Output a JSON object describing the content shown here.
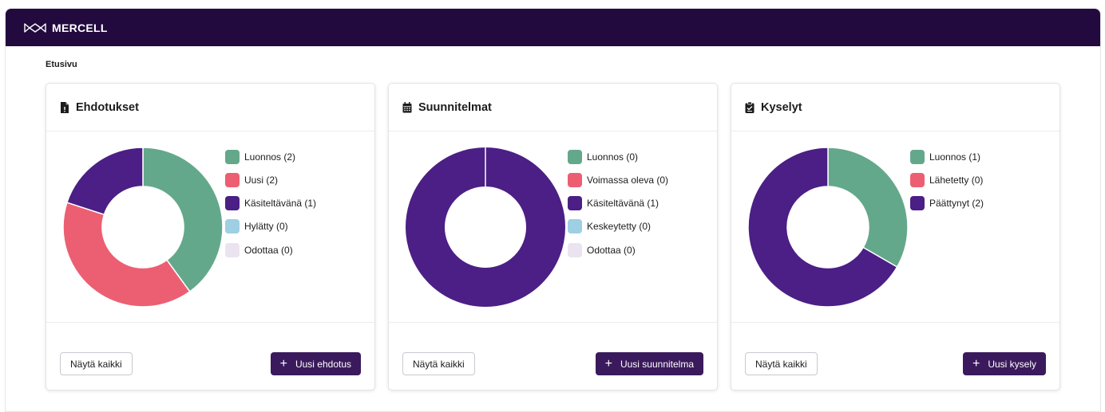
{
  "app": {
    "brand_name": "MERCELL",
    "brand_color": "#220a3f",
    "logo_icon": "mercell-logo-icon"
  },
  "breadcrumb": "Etusivu",
  "cards": [
    {
      "title": "Ehdotukset",
      "icon": "file-icon",
      "legend": [
        {
          "label": "Luonnos (2)",
          "color": "#64a88b"
        },
        {
          "label": "Uusi (2)",
          "color": "#ec5f72"
        },
        {
          "label": "Käsiteltävänä (1)",
          "color": "#4b1f85"
        },
        {
          "label": "Hylätty (0)",
          "color": "#9ecfe2"
        },
        {
          "label": "Odottaa (0)",
          "color": "#ebe4f0"
        }
      ],
      "show_all_label": "Näytä kaikki",
      "new_label": "Uusi ehdotus"
    },
    {
      "title": "Suunnitelmat",
      "icon": "calendar-icon",
      "legend": [
        {
          "label": "Luonnos (0)",
          "color": "#64a88b"
        },
        {
          "label": "Voimassa oleva (0)",
          "color": "#ec5f72"
        },
        {
          "label": "Käsiteltävänä (1)",
          "color": "#4b1f85"
        },
        {
          "label": "Keskeytetty (0)",
          "color": "#9ecfe2"
        },
        {
          "label": "Odottaa (0)",
          "color": "#ebe4f0"
        }
      ],
      "show_all_label": "Näytä kaikki",
      "new_label": "Uusi suunnitelma"
    },
    {
      "title": "Kyselyt",
      "icon": "clipboard-icon",
      "legend": [
        {
          "label": "Luonnos (1)",
          "color": "#64a88b"
        },
        {
          "label": "Lähetetty (0)",
          "color": "#ec5f72"
        },
        {
          "label": "Päättynyt (2)",
          "color": "#4b1f85"
        }
      ],
      "show_all_label": "Näytä kaikki",
      "new_label": "Uusi kysely"
    }
  ],
  "chart_data": [
    {
      "type": "pie",
      "categories": [
        "Luonnos",
        "Uusi",
        "Käsiteltävänä",
        "Hylätty",
        "Odottaa"
      ],
      "values": [
        2,
        2,
        1,
        0,
        0
      ],
      "colors": [
        "#64a88b",
        "#ec5f72",
        "#4b1f85",
        "#9ecfe2",
        "#ebe4f0"
      ],
      "legend": "right"
    },
    {
      "type": "pie",
      "categories": [
        "Luonnos",
        "Voimassa oleva",
        "Käsiteltävänä",
        "Keskeytetty",
        "Odottaa"
      ],
      "values": [
        0,
        0,
        1,
        0,
        0
      ],
      "colors": [
        "#64a88b",
        "#ec5f72",
        "#4b1f85",
        "#9ecfe2",
        "#ebe4f0"
      ],
      "legend": "right"
    },
    {
      "type": "pie",
      "categories": [
        "Luonnos",
        "Lähetetty",
        "Päättynyt"
      ],
      "values": [
        1,
        0,
        2
      ],
      "colors": [
        "#64a88b",
        "#ec5f72",
        "#4b1f85"
      ],
      "legend": "right"
    }
  ]
}
